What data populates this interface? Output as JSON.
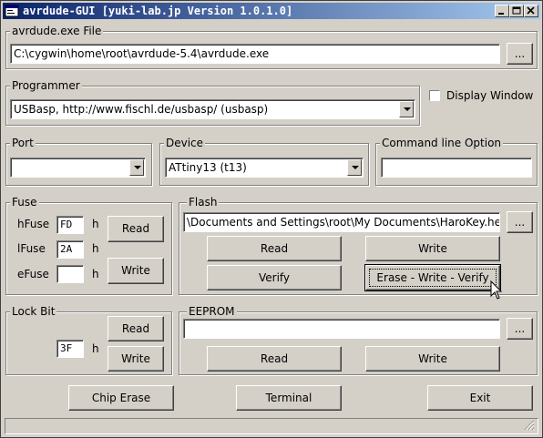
{
  "window": {
    "title": "avrdude-GUI [yuki-lab.jp Version 1.0.1.0]"
  },
  "avrdude_file": {
    "label": "avrdude.exe File",
    "value": "C:\\cygwin\\home\\root\\avrdude-5.4\\avrdude.exe",
    "browse": "..."
  },
  "programmer": {
    "label": "Programmer",
    "value": "USBasp, http://www.fischl.de/usbasp/ (usbasp)"
  },
  "display_window": {
    "label": "Display Window",
    "checked": false
  },
  "port": {
    "label": "Port",
    "value": ""
  },
  "device": {
    "label": "Device",
    "value": "ATtiny13 (t13)"
  },
  "command_line": {
    "label": "Command line Option",
    "value": ""
  },
  "fuse": {
    "label": "Fuse",
    "hfuse_label": "hFuse",
    "hfuse_value": "FD",
    "lfuse_label": "lFuse",
    "lfuse_value": "2A",
    "efuse_label": "eFuse",
    "efuse_value": "",
    "unit": "h",
    "read": "Read",
    "write": "Write"
  },
  "flash": {
    "label": "Flash",
    "value": "\\Documents and Settings\\root\\My Documents\\HaroKey.hex",
    "browse": "...",
    "read": "Read",
    "write": "Write",
    "verify": "Verify",
    "erase_write_verify": "Erase - Write - Verify"
  },
  "lock_bit": {
    "label": "Lock Bit",
    "value": "3F",
    "unit": "h",
    "read": "Read",
    "write": "Write"
  },
  "eeprom": {
    "label": "EEPROM",
    "value": "",
    "browse": "...",
    "read": "Read",
    "write": "Write"
  },
  "footer": {
    "chip_erase": "Chip Erase",
    "terminal": "Terminal",
    "exit": "Exit"
  },
  "colors": {
    "face": "#d4d0c8",
    "title_start": "#0a246a",
    "title_end": "#a6caf0"
  }
}
